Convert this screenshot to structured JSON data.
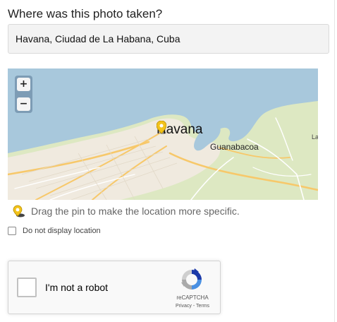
{
  "question": "Where was this photo taken?",
  "location": {
    "value": "Havana, Ciudad de La Habana, Cuba",
    "placeholder": ""
  },
  "map": {
    "zoom_in_label": "+",
    "zoom_out_label": "−",
    "labels": {
      "city": "Havana",
      "guanabacoa": "Guanabacoa",
      "partial": "La"
    },
    "colors": {
      "water": "#a8c8dc",
      "land": "#f0eadf",
      "park": "#dde8c2",
      "road": "#f7c86a",
      "pin": "#f2c21b"
    }
  },
  "hint": "Drag the pin to make the location more specific.",
  "hide_location": {
    "label": "Do not display location",
    "checked": false
  },
  "recaptcha": {
    "label": "I'm not a robot",
    "brand": "reCAPTCHA",
    "privacy": "Privacy",
    "separator": " - ",
    "terms": "Terms"
  }
}
